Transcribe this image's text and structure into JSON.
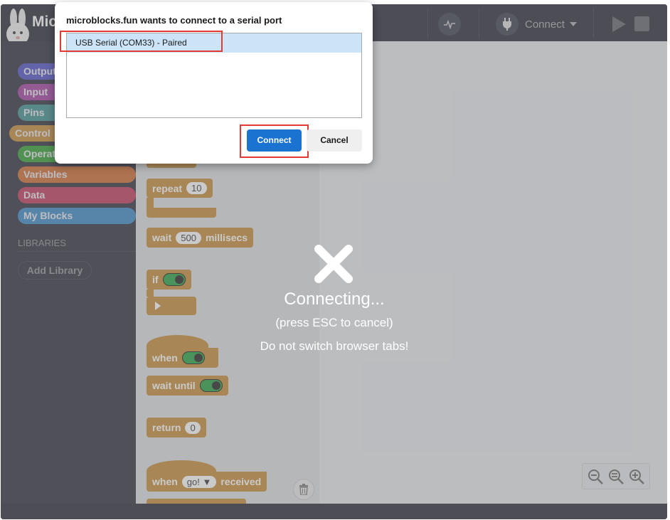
{
  "app": {
    "title": "Mic",
    "connect_label": "Connect"
  },
  "sidebar": {
    "categories": [
      {
        "label": "Output",
        "color": "#4f4fc7"
      },
      {
        "label": "Input",
        "color": "#a23fa3"
      },
      {
        "label": "Pins",
        "color": "#3f8f8f"
      },
      {
        "label": "Control",
        "color": "#c48a37"
      },
      {
        "label": "Operators",
        "color": "#2f9d2f"
      },
      {
        "label": "Variables",
        "color": "#cf6a2f"
      },
      {
        "label": "Data",
        "color": "#c2385a"
      },
      {
        "label": "My Blocks",
        "color": "#3a88c8"
      }
    ],
    "libraries_label": "LIBRARIES",
    "add_library": "Add Library"
  },
  "palette": {
    "repeat": {
      "label": "repeat",
      "count": "10"
    },
    "wait": {
      "label": "wait",
      "value": "500",
      "unit": "millisecs"
    },
    "if": {
      "label": "if"
    },
    "when": {
      "label": "when"
    },
    "wait_until": {
      "label": "wait until"
    },
    "return": {
      "label": "return",
      "value": "0"
    },
    "when_received": {
      "label": "when",
      "message": "go! ▼",
      "suffix": "received"
    }
  },
  "overlay": {
    "title": "Connecting...",
    "esc_hint": "(press ESC to cancel)",
    "tabs_hint": "Do not switch browser tabs!"
  },
  "dialog": {
    "title": "microblocks.fun wants to connect to a serial port",
    "port": "USB Serial (COM33) - Paired",
    "connect": "Connect",
    "cancel": "Cancel"
  },
  "colors": {
    "accent_blue": "#1a73d1",
    "highlight_red": "#e53935",
    "block_orange": "#c48a37"
  }
}
